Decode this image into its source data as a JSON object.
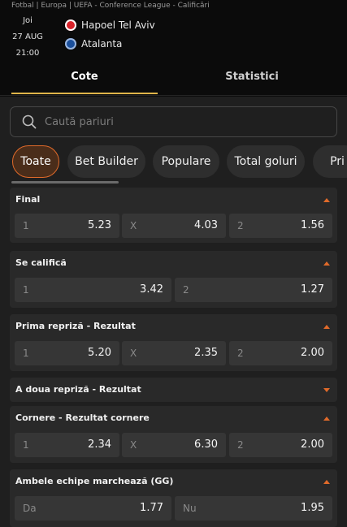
{
  "header": {
    "breadcrumb": "Fotbal | Europa | UEFA - Conference League - Calificări",
    "day": "Joi",
    "date": "27 AUG",
    "time": "21:00",
    "home_team": "Hapoel Tel Aviv",
    "away_team": "Atalanta"
  },
  "tabs": [
    {
      "label": "Cote",
      "active": true
    },
    {
      "label": "Statistici",
      "active": false
    }
  ],
  "search": {
    "placeholder": "Caută pariuri"
  },
  "filters": [
    "Toate",
    "Bet Builder",
    "Populare",
    "Total goluri",
    "Pri"
  ],
  "markets": [
    {
      "title": "Final",
      "expanded": true,
      "odds": [
        {
          "label": "1",
          "value": "5.23"
        },
        {
          "label": "X",
          "value": "4.03"
        },
        {
          "label": "2",
          "value": "1.56"
        }
      ]
    },
    {
      "title": "Se califică",
      "expanded": true,
      "odds": [
        {
          "label": "1",
          "value": "3.42"
        },
        {
          "label": "2",
          "value": "1.27"
        }
      ]
    },
    {
      "title": "Prima repriză - Rezultat",
      "expanded": true,
      "odds": [
        {
          "label": "1",
          "value": "5.20"
        },
        {
          "label": "X",
          "value": "2.35"
        },
        {
          "label": "2",
          "value": "2.00"
        }
      ]
    },
    {
      "title": "A doua repriză - Rezultat",
      "expanded": false,
      "odds": []
    },
    {
      "title": "Cornere - Rezultat cornere",
      "expanded": true,
      "odds": [
        {
          "label": "1",
          "value": "2.34"
        },
        {
          "label": "X",
          "value": "6.30"
        },
        {
          "label": "2",
          "value": "2.00"
        }
      ]
    },
    {
      "title": "Ambele echipe marchează (GG)",
      "expanded": true,
      "odds": [
        {
          "label": "Da",
          "value": "1.77"
        },
        {
          "label": "Nu",
          "value": "1.95"
        }
      ]
    }
  ],
  "colors": {
    "accent": "#e06a2a",
    "tab_underline": "#e0b54a",
    "background": "#1f1f1f",
    "card": "#292929"
  },
  "icons": {
    "search": "search-icon",
    "expanded": "triangle-up-icon",
    "collapsed": "triangle-down-icon"
  }
}
